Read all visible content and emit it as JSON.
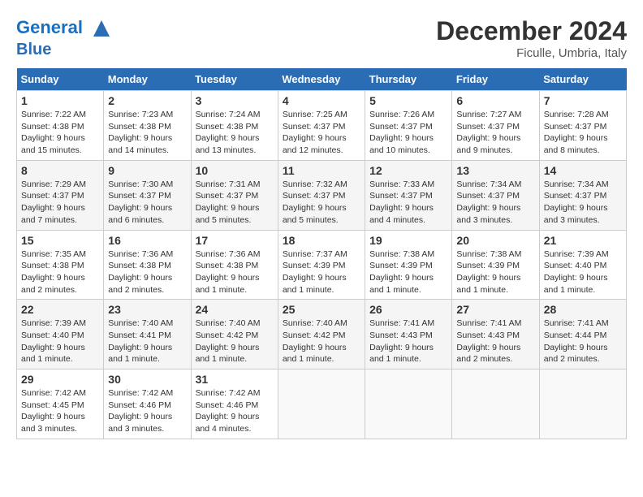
{
  "header": {
    "logo_line1": "General",
    "logo_line2": "Blue",
    "month_title": "December 2024",
    "location": "Ficulle, Umbria, Italy"
  },
  "days_of_week": [
    "Sunday",
    "Monday",
    "Tuesday",
    "Wednesday",
    "Thursday",
    "Friday",
    "Saturday"
  ],
  "weeks": [
    [
      {
        "day": 1,
        "detail": "Sunrise: 7:22 AM\nSunset: 4:38 PM\nDaylight: 9 hours\nand 15 minutes."
      },
      {
        "day": 2,
        "detail": "Sunrise: 7:23 AM\nSunset: 4:38 PM\nDaylight: 9 hours\nand 14 minutes."
      },
      {
        "day": 3,
        "detail": "Sunrise: 7:24 AM\nSunset: 4:38 PM\nDaylight: 9 hours\nand 13 minutes."
      },
      {
        "day": 4,
        "detail": "Sunrise: 7:25 AM\nSunset: 4:37 PM\nDaylight: 9 hours\nand 12 minutes."
      },
      {
        "day": 5,
        "detail": "Sunrise: 7:26 AM\nSunset: 4:37 PM\nDaylight: 9 hours\nand 10 minutes."
      },
      {
        "day": 6,
        "detail": "Sunrise: 7:27 AM\nSunset: 4:37 PM\nDaylight: 9 hours\nand 9 minutes."
      },
      {
        "day": 7,
        "detail": "Sunrise: 7:28 AM\nSunset: 4:37 PM\nDaylight: 9 hours\nand 8 minutes."
      }
    ],
    [
      {
        "day": 8,
        "detail": "Sunrise: 7:29 AM\nSunset: 4:37 PM\nDaylight: 9 hours\nand 7 minutes."
      },
      {
        "day": 9,
        "detail": "Sunrise: 7:30 AM\nSunset: 4:37 PM\nDaylight: 9 hours\nand 6 minutes."
      },
      {
        "day": 10,
        "detail": "Sunrise: 7:31 AM\nSunset: 4:37 PM\nDaylight: 9 hours\nand 5 minutes."
      },
      {
        "day": 11,
        "detail": "Sunrise: 7:32 AM\nSunset: 4:37 PM\nDaylight: 9 hours\nand 5 minutes."
      },
      {
        "day": 12,
        "detail": "Sunrise: 7:33 AM\nSunset: 4:37 PM\nDaylight: 9 hours\nand 4 minutes."
      },
      {
        "day": 13,
        "detail": "Sunrise: 7:34 AM\nSunset: 4:37 PM\nDaylight: 9 hours\nand 3 minutes."
      },
      {
        "day": 14,
        "detail": "Sunrise: 7:34 AM\nSunset: 4:37 PM\nDaylight: 9 hours\nand 3 minutes."
      }
    ],
    [
      {
        "day": 15,
        "detail": "Sunrise: 7:35 AM\nSunset: 4:38 PM\nDaylight: 9 hours\nand 2 minutes."
      },
      {
        "day": 16,
        "detail": "Sunrise: 7:36 AM\nSunset: 4:38 PM\nDaylight: 9 hours\nand 2 minutes."
      },
      {
        "day": 17,
        "detail": "Sunrise: 7:36 AM\nSunset: 4:38 PM\nDaylight: 9 hours\nand 1 minute."
      },
      {
        "day": 18,
        "detail": "Sunrise: 7:37 AM\nSunset: 4:39 PM\nDaylight: 9 hours\nand 1 minute."
      },
      {
        "day": 19,
        "detail": "Sunrise: 7:38 AM\nSunset: 4:39 PM\nDaylight: 9 hours\nand 1 minute."
      },
      {
        "day": 20,
        "detail": "Sunrise: 7:38 AM\nSunset: 4:39 PM\nDaylight: 9 hours\nand 1 minute."
      },
      {
        "day": 21,
        "detail": "Sunrise: 7:39 AM\nSunset: 4:40 PM\nDaylight: 9 hours\nand 1 minute."
      }
    ],
    [
      {
        "day": 22,
        "detail": "Sunrise: 7:39 AM\nSunset: 4:40 PM\nDaylight: 9 hours\nand 1 minute."
      },
      {
        "day": 23,
        "detail": "Sunrise: 7:40 AM\nSunset: 4:41 PM\nDaylight: 9 hours\nand 1 minute."
      },
      {
        "day": 24,
        "detail": "Sunrise: 7:40 AM\nSunset: 4:42 PM\nDaylight: 9 hours\nand 1 minute."
      },
      {
        "day": 25,
        "detail": "Sunrise: 7:40 AM\nSunset: 4:42 PM\nDaylight: 9 hours\nand 1 minute."
      },
      {
        "day": 26,
        "detail": "Sunrise: 7:41 AM\nSunset: 4:43 PM\nDaylight: 9 hours\nand 1 minute."
      },
      {
        "day": 27,
        "detail": "Sunrise: 7:41 AM\nSunset: 4:43 PM\nDaylight: 9 hours\nand 2 minutes."
      },
      {
        "day": 28,
        "detail": "Sunrise: 7:41 AM\nSunset: 4:44 PM\nDaylight: 9 hours\nand 2 minutes."
      }
    ],
    [
      {
        "day": 29,
        "detail": "Sunrise: 7:42 AM\nSunset: 4:45 PM\nDaylight: 9 hours\nand 3 minutes."
      },
      {
        "day": 30,
        "detail": "Sunrise: 7:42 AM\nSunset: 4:46 PM\nDaylight: 9 hours\nand 3 minutes."
      },
      {
        "day": 31,
        "detail": "Sunrise: 7:42 AM\nSunset: 4:46 PM\nDaylight: 9 hours\nand 4 minutes."
      },
      null,
      null,
      null,
      null
    ]
  ]
}
